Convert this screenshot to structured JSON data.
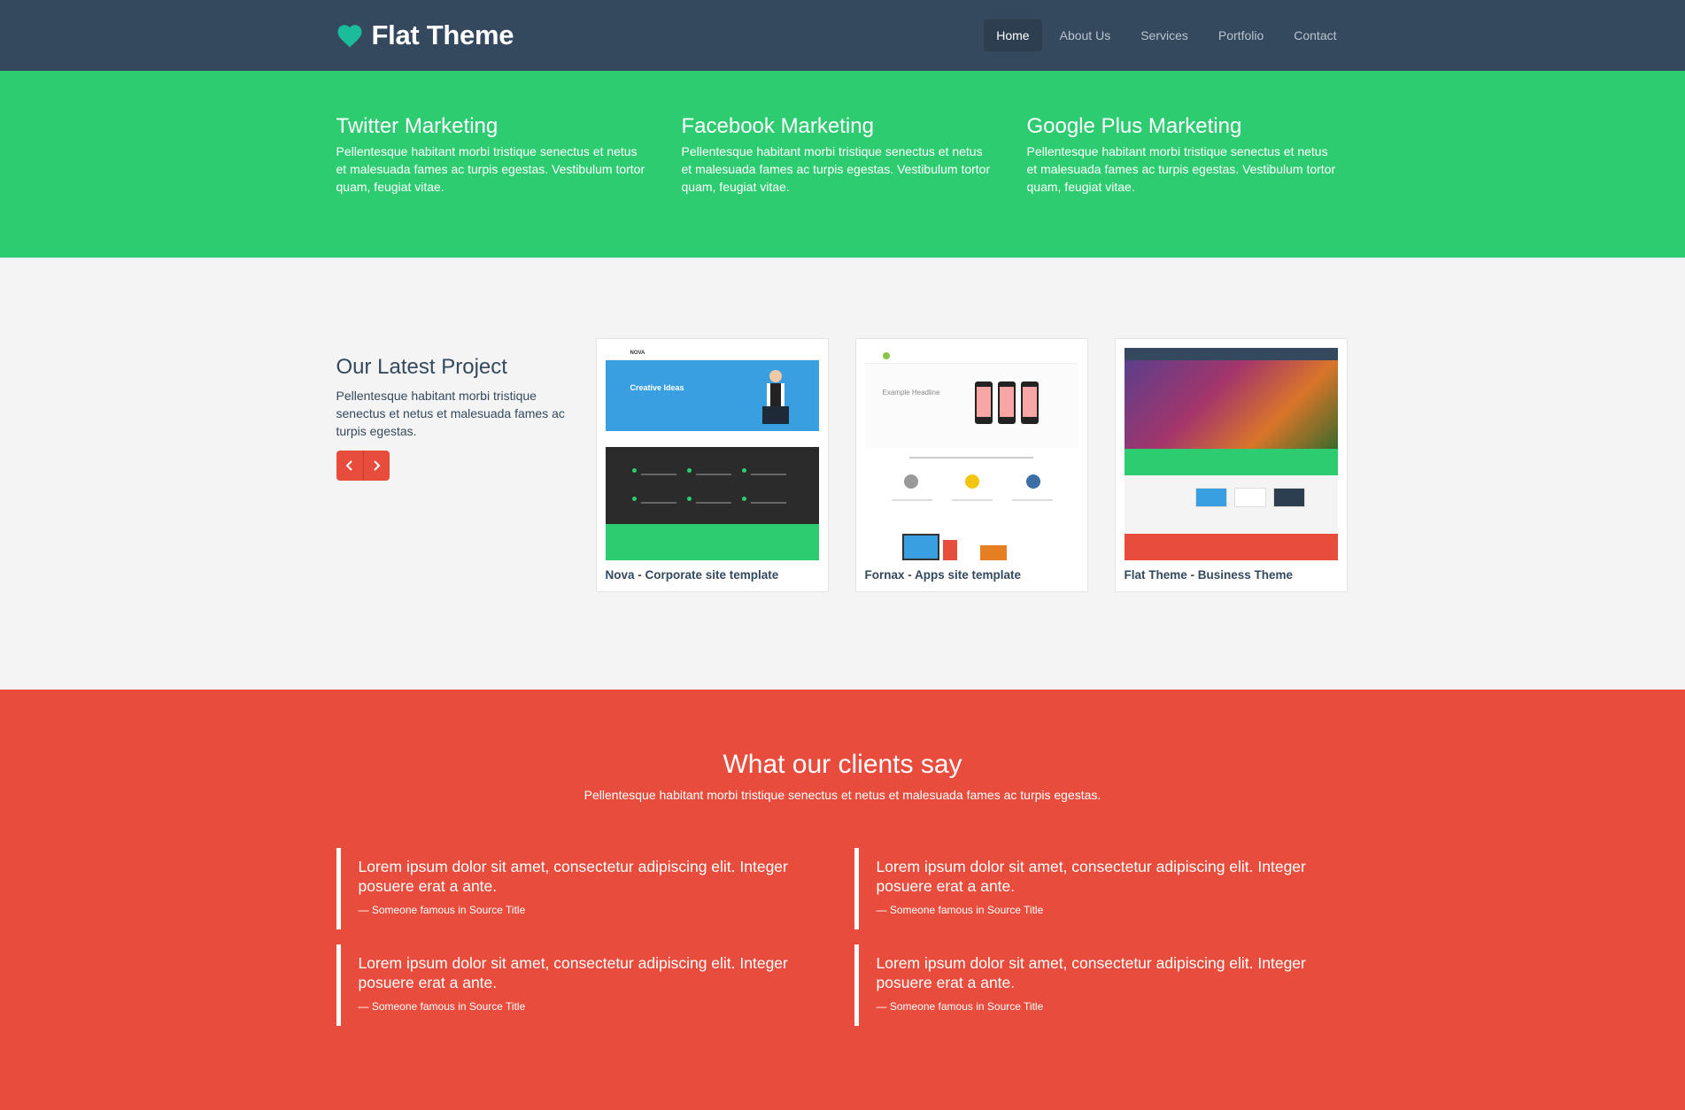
{
  "header": {
    "brand": "Flat Theme",
    "nav": [
      {
        "label": "Home",
        "active": true
      },
      {
        "label": "About Us",
        "active": false
      },
      {
        "label": "Services",
        "active": false
      },
      {
        "label": "Portfolio",
        "active": false
      },
      {
        "label": "Contact",
        "active": false
      }
    ]
  },
  "services": [
    {
      "title": "Twitter Marketing",
      "text": "Pellentesque habitant morbi tristique senectus et netus et malesuada fames ac turpis egestas. Vestibulum tortor quam, feugiat vitae."
    },
    {
      "title": "Facebook Marketing",
      "text": "Pellentesque habitant morbi tristique senectus et netus et malesuada fames ac turpis egestas. Vestibulum tortor quam, feugiat vitae."
    },
    {
      "title": "Google Plus Marketing",
      "text": "Pellentesque habitant morbi tristique senectus et netus et malesuada fames ac turpis egestas. Vestibulum tortor quam, feugiat vitae."
    }
  ],
  "projects": {
    "title": "Our Latest Project",
    "text": "Pellentesque habitant morbi tristique senectus et netus et malesuada fames ac turpis egestas.",
    "prev_icon": "chevron-left-icon",
    "next_icon": "chevron-right-icon",
    "cards": [
      {
        "title": "Nova - Corporate site template",
        "hero_text": "Creative Ideas"
      },
      {
        "title": "Fornax - Apps site template",
        "hero_text": "Example Headline"
      },
      {
        "title": "Flat Theme - Business Theme"
      }
    ]
  },
  "testimonials": {
    "title": "What our clients say",
    "subtitle": "Pellentesque habitant morbi tristique senectus et netus et malesuada fames ac turpis egestas.",
    "quotes": [
      {
        "text": "Lorem ipsum dolor sit amet, consectetur adipiscing elit. Integer posuere erat a ante.",
        "source": "— Someone famous in Source Title"
      },
      {
        "text": "Lorem ipsum dolor sit amet, consectetur adipiscing elit. Integer posuere erat a ante.",
        "source": "— Someone famous in Source Title"
      },
      {
        "text": "Lorem ipsum dolor sit amet, consectetur adipiscing elit. Integer posuere erat a ante.",
        "source": "— Someone famous in Source Title"
      },
      {
        "text": "Lorem ipsum dolor sit amet, consectetur adipiscing elit. Integer posuere erat a ante.",
        "source": "— Someone famous in Source Title"
      }
    ]
  },
  "colors": {
    "header": "#34495e",
    "green": "#2ecc71",
    "red": "#e74c3c",
    "logo_heart": "#1abc9c"
  }
}
